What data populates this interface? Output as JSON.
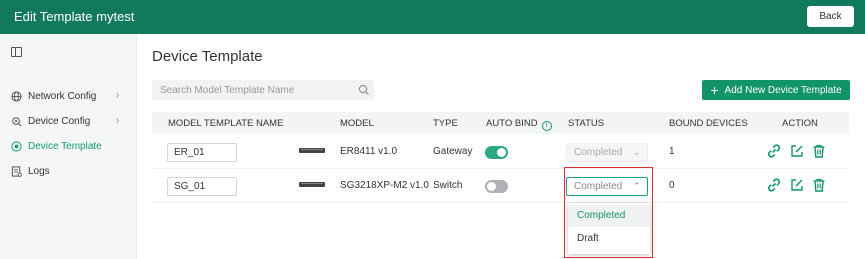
{
  "header": {
    "title": "Edit Template mytest",
    "back_label": "Back"
  },
  "sidebar": {
    "items": [
      {
        "label": "Network Config",
        "icon": "globe-icon",
        "has_chevron": true,
        "active": false
      },
      {
        "label": "Device Config",
        "icon": "device-config-icon",
        "has_chevron": true,
        "active": false
      },
      {
        "label": "Device Template",
        "icon": "template-icon",
        "has_chevron": false,
        "active": true
      },
      {
        "label": "Logs",
        "icon": "logs-icon",
        "has_chevron": false,
        "active": false
      }
    ]
  },
  "main": {
    "title": "Device Template",
    "search_placeholder": "Search Model Template Name",
    "add_button_label": "Add New Device Template",
    "columns": [
      "MODEL TEMPLATE NAME",
      "MODEL",
      "TYPE",
      "AUTO BIND",
      "STATUS",
      "BOUND DEVICES",
      "ACTION"
    ],
    "rows": [
      {
        "name": "ER_01",
        "model": "ER8411 v1.0",
        "type": "Gateway",
        "auto_bind": true,
        "status": "Completed",
        "bound_devices": "1"
      },
      {
        "name": "SG_01",
        "model": "SG3218XP-M2 v1.0",
        "type": "Switch",
        "auto_bind": false,
        "status": "Completed",
        "bound_devices": "0"
      }
    ],
    "status_dropdown": {
      "options": [
        "Completed",
        "Draft"
      ],
      "selected": "Completed"
    }
  },
  "colors": {
    "brand": "#127a5c",
    "accent": "#129469",
    "toggle_on": "#2aaa83",
    "highlight": "#e02e2e"
  }
}
